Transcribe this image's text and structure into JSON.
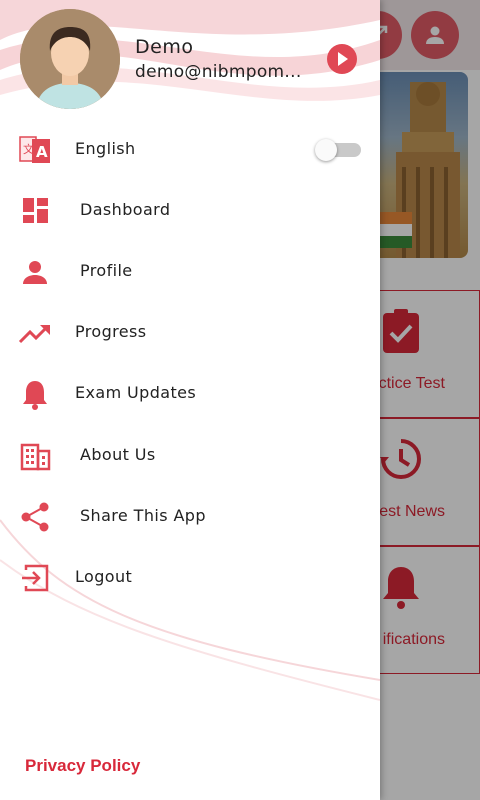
{
  "background": {
    "tiles": [
      {
        "label": "ctice Test",
        "icon": "clipboard-check-icon"
      },
      {
        "label": "est News",
        "icon": "history-icon"
      },
      {
        "label": "ifications",
        "icon": "bell-icon"
      }
    ]
  },
  "drawer": {
    "user": {
      "name": "Demo",
      "email": "demo@nibmpom..."
    },
    "menu": [
      {
        "label": "English",
        "icon": "translate-icon"
      },
      {
        "label": "Dashboard",
        "icon": "dashboard-icon"
      },
      {
        "label": "Profile",
        "icon": "person-icon"
      },
      {
        "label": "Progress",
        "icon": "trending-up-icon"
      },
      {
        "label": "Exam Updates",
        "icon": "bell-icon"
      },
      {
        "label": "About Us",
        "icon": "building-icon"
      },
      {
        "label": "Share This App",
        "icon": "share-icon"
      },
      {
        "label": "Logout",
        "icon": "logout-icon"
      }
    ],
    "language_toggle_on": false,
    "privacy_label": "Privacy Policy"
  },
  "colors": {
    "accent": "#d8283a",
    "icon": "#e04855"
  }
}
